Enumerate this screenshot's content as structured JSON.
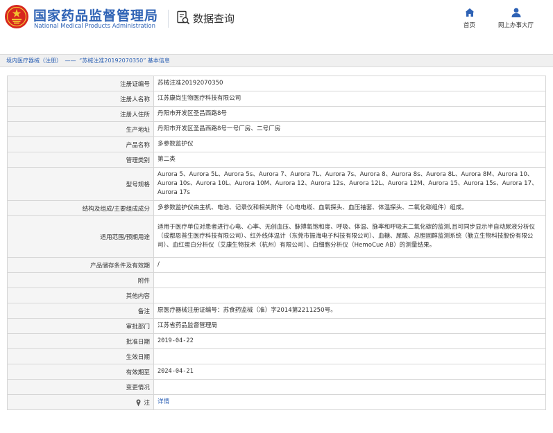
{
  "header": {
    "brand_cn": "国家药品监督管理局",
    "brand_en": "National Medical Products Administration",
    "query_title": "数据查询",
    "nav_home": "首页",
    "nav_online": "网上办事大厅"
  },
  "breadcrumb": {
    "item1": "境内医疗器械（注册）",
    "separator": "——",
    "item2": "“苏械注准20192070350”",
    "item3": "基本信息"
  },
  "details": {
    "registration_no": {
      "label": "注册证编号",
      "value": "苏械注准20192070350"
    },
    "registrant_name": {
      "label": "注册人名称",
      "value": "江苏康尚生物医疗科技有限公司"
    },
    "registrant_address": {
      "label": "注册人住所",
      "value": "丹阳市开发区圣昌西路8号"
    },
    "production_address": {
      "label": "生产地址",
      "value": "丹阳市开发区圣昌西路8号一号厂房、二号厂房"
    },
    "product_name": {
      "label": "产品名称",
      "value": "多参数监护仪"
    },
    "management_class": {
      "label": "管理类别",
      "value": "第二类"
    },
    "models": {
      "label": "型号规格",
      "value": "Aurora 5、Aurora 5L、Aurora 5s、Aurora 7、Aurora 7L、Aurora 7s、Aurora 8、Aurora 8s、Aurora 8L、Aurora 8M、Aurora 10、Aurora 10s、Aurora 10L、Aurora 10M、Aurora 12、Aurora 12s、Aurora 12L、Aurora 12M、Aurora 15、Aurora 15s、Aurora 17、Aurora 17s"
    },
    "structure": {
      "label": "结构及组成/主要组成成分",
      "value": "多参数监护仪由主机、电池、记录仪和相关附件（心电电缆、血氧探头、血压袖套、体温探头、二氧化碳组件）组成。"
    },
    "intended_use": {
      "label": "适用范围/预期用途",
      "value": "适用于医疗单位对患者进行心电、心率、无创血压、脉搏氧饱和度、呼吸、体温、脉率和呼吸末二氧化碳的监测,且可同步显示半自动尿液分析仪（成都恩普生医疗科技有限公司）、红外线体温计（东莞市振海电子科技有限公司）、血糖、尿酸、总胆固醇监测系统（勤立生物科技股份有限公司）、血红蛋白分析仪（艾康生物技术（杭州）有限公司）、白细胞分析仪（HemoCue AB）的测量结果。"
    },
    "storage": {
      "label": "产品储存条件及有效期",
      "value": "/"
    },
    "attachment": {
      "label": "附件",
      "value": ""
    },
    "other": {
      "label": "其他内容",
      "value": ""
    },
    "remarks": {
      "label": "备注",
      "value": "原医疗器械注册证编号：苏食药监械（准）字2014第2211250号。"
    },
    "approval_dept": {
      "label": "审批部门",
      "value": "江苏省药品监督管理局"
    },
    "approval_date": {
      "label": "批准日期",
      "value": "2019-04-22"
    },
    "effective_date": {
      "label": "生效日期",
      "value": ""
    },
    "expiry_date": {
      "label": "有效期至",
      "value": "2024-04-21"
    },
    "changes": {
      "label": "变更情况",
      "value": ""
    },
    "note": {
      "label": "注",
      "value": "详情"
    }
  },
  "colors": {
    "brand_blue": "#2e62b5",
    "logo_red": "#d7261e",
    "logo_gold": "#f2c230",
    "label_bg": "#f5f5f5",
    "border": "#d6d6d6"
  },
  "icons": {
    "logo": "national-emblem-icon",
    "query": "document-search-icon",
    "home": "home-icon",
    "online": "user-icon",
    "note": "pin-icon"
  }
}
